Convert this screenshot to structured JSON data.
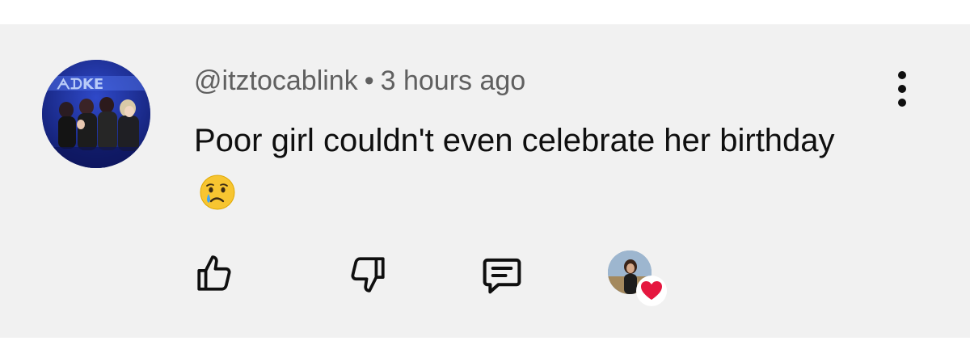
{
  "comment": {
    "handle": "@itztocablink",
    "separator": "•",
    "timestamp": "3 hours ago",
    "text": "Poor girl couldn't even celebrate her birthday",
    "emoji": "crying-face"
  },
  "actions": {
    "like_icon": "thumbs-up-icon",
    "dislike_icon": "thumbs-down-icon",
    "reply_icon": "comment-bubble-icon",
    "more_icon": "vertical-ellipsis-icon",
    "creator_heart_icon": "heart-icon"
  },
  "colors": {
    "card_background": "#f1f1f1",
    "meta_text": "#606060",
    "body_text": "#0f0f0f",
    "heart": "#e5173f"
  }
}
